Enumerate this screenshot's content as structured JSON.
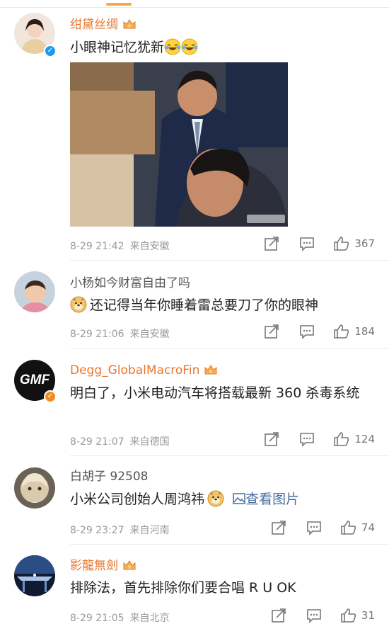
{
  "comments": [
    {
      "name": "绀黛丝绸",
      "text": "小眼神记忆犹新",
      "emoji": [
        "laughing-crying-emoji",
        "laughing-crying-emoji"
      ],
      "date": "8-29 21:42",
      "location": "来自安徽",
      "likes": "367",
      "verified": true,
      "has_image": true
    },
    {
      "name": "小杨如今财富自由了吗",
      "text": "还记得当年你睡着雷总要刀了你的眼神",
      "emoji": [
        "doge-emoji"
      ],
      "date": "8-29 21:06",
      "location": "来自安徽",
      "likes": "184"
    },
    {
      "name": "Degg_GlobalMacroFin",
      "avatar_text": "GMF",
      "text": "明白了，小米电动汽车将搭载最新 360 杀毒系统",
      "date": "8-29 21:07",
      "location": "来自德国",
      "likes": "124"
    },
    {
      "name": "白胡子 92508",
      "text": "小米公司创始人周鸿祎",
      "emoji": [
        "doge-emoji"
      ],
      "link_text": "查看图片",
      "date": "8-29 23:27",
      "location": "来自河南",
      "likes": "74"
    },
    {
      "name": "影龍無劍",
      "text": "排除法，首先排除你们要合唱 R U OK",
      "date": "8-29 21:05",
      "location": "来自北京",
      "likes": "31"
    }
  ],
  "colors": {
    "vip_name": "#e8772e",
    "link": "#4a6d9c",
    "verified": "#1d9bf0"
  }
}
